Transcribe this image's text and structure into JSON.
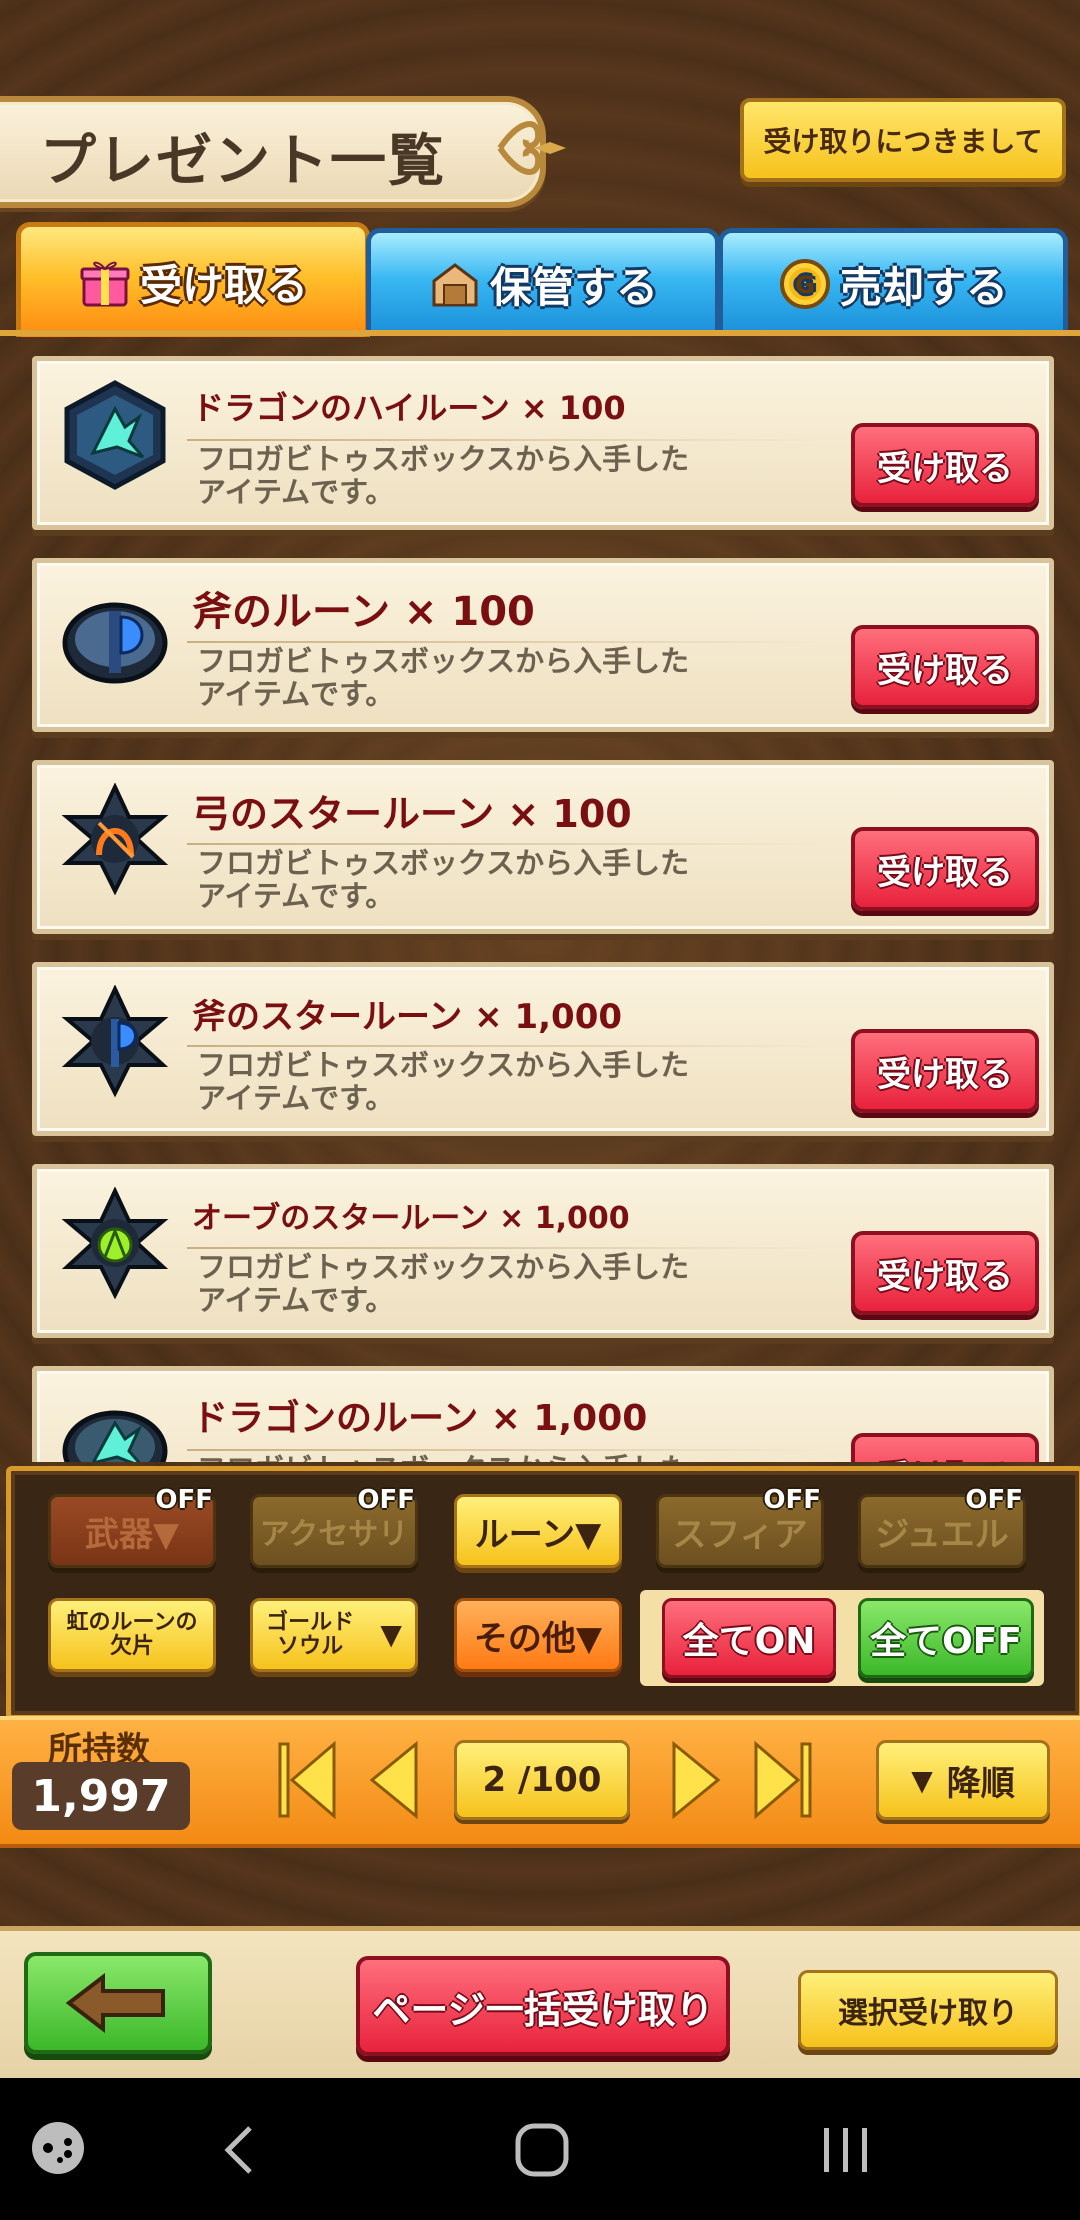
{
  "header": {
    "title": "プレゼント一覧",
    "notice_button": "受け取りにつきまして"
  },
  "tabs": [
    {
      "label": "受け取る",
      "icon": "gift-icon",
      "active": true
    },
    {
      "label": "保管する",
      "icon": "storage-box-icon",
      "active": false
    },
    {
      "label": "売却する",
      "icon": "gold-coin-icon",
      "active": false
    }
  ],
  "items": [
    {
      "name": "ドラゴンのハイルーン × 100",
      "desc": "フロガビトゥスボックスから入手した\nアイテムです。",
      "button": "受け取る",
      "icon": "dragon-high-rune-icon"
    },
    {
      "name": "斧のルーン × 100",
      "desc": "フロガビトゥスボックスから入手した\nアイテムです。",
      "button": "受け取る",
      "icon": "axe-rune-icon"
    },
    {
      "name": "弓のスタールーン × 100",
      "desc": "フロガビトゥスボックスから入手した\nアイテムです。",
      "button": "受け取る",
      "icon": "bow-star-rune-icon"
    },
    {
      "name": "斧のスタールーン × 1,000",
      "desc": "フロガビトゥスボックスから入手した\nアイテムです。",
      "button": "受け取る",
      "icon": "axe-star-rune-icon"
    },
    {
      "name": "オーブのスタールーン × 1,000",
      "desc": "フロガビトゥスボックスから入手した\nアイテムです。",
      "button": "受け取る",
      "icon": "orb-star-rune-icon"
    },
    {
      "name": "ドラゴンのルーン × 1,000",
      "desc": "フロガビトゥスボックスから入手した\nアイテムです。",
      "button": "受け取る",
      "icon": "dragon-rune-icon"
    }
  ],
  "filters": {
    "off_label": "OFF",
    "row1": [
      {
        "label": "武器▼",
        "state": "off"
      },
      {
        "label": "アクセサリ",
        "state": "off"
      },
      {
        "label": "ルーン▼",
        "state": "on"
      },
      {
        "label": "スフィア",
        "state": "off"
      },
      {
        "label": "ジュエル",
        "state": "off"
      }
    ],
    "row2": [
      {
        "label": "虹のルーンの\n欠片",
        "state": "on"
      },
      {
        "label": "ゴールド\nソウル",
        "state": "on"
      },
      {
        "label": "その他▼",
        "state": "on"
      }
    ],
    "all_on": "全てON",
    "all_off": "全てOFF"
  },
  "pagination": {
    "count_label": "所持数",
    "count": "1,997",
    "page": "2 /100",
    "sort_label": "降順"
  },
  "bottom": {
    "page_receive": "ページ一括受け取り",
    "select_receive": "選択受け取り"
  },
  "colors": {
    "accent_red": "#e8223c",
    "accent_yellow": "#f6c21c",
    "accent_green": "#3cb82a",
    "tab_blue": "#38b7f2",
    "background_brown": "#4a2f18"
  }
}
